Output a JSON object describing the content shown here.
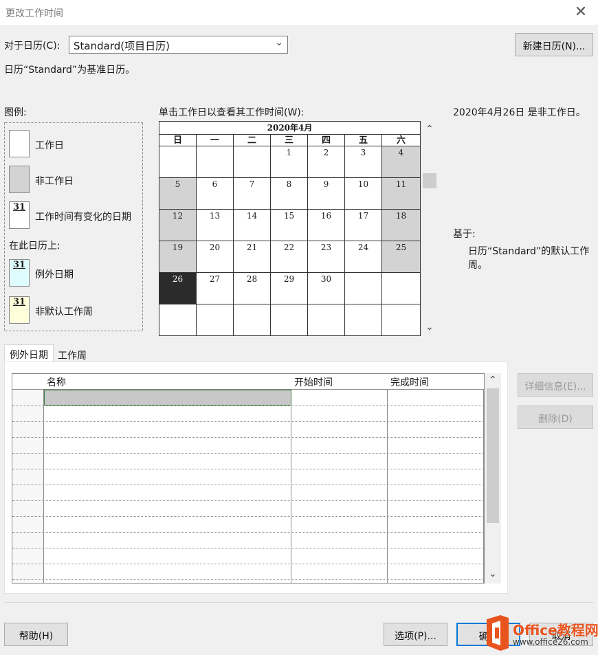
{
  "window": {
    "title": "更改工作时间",
    "close_glyph": "✕"
  },
  "calendar_select": {
    "label": "对于日历(C):",
    "value": "Standard(项目日历)",
    "chevron": "⌄"
  },
  "base_note": "日历“Standard”为基准日历。",
  "new_calendar_button": "新建日历(N)...",
  "legend": {
    "heading": "图例:",
    "items": [
      {
        "label": "工作日",
        "swatch": "",
        "bg": "#ffffff"
      },
      {
        "label": "非工作日",
        "swatch": "",
        "bg": "#d3d3d3"
      },
      {
        "label": "工作时间有变化的日期",
        "swatch": "31",
        "bg": "#ffffff"
      }
    ],
    "on_calendar_heading": "在此日历上:",
    "calendar_items": [
      {
        "label": "例外日期",
        "swatch": "31",
        "bg": "#dffdff"
      },
      {
        "label": "非默认工作周",
        "swatch": "31",
        "bg": "#ffffdc"
      }
    ]
  },
  "calendar": {
    "instruction": "单击工作日以查看其工作时间(W):",
    "month_title": "2020年4月",
    "weekdays": [
      "日",
      "一",
      "二",
      "三",
      "四",
      "五",
      "六"
    ],
    "weeks": [
      [
        "",
        "",
        "",
        "1",
        "2",
        "3",
        "4"
      ],
      [
        "5",
        "6",
        "7",
        "8",
        "9",
        "10",
        "11"
      ],
      [
        "12",
        "13",
        "14",
        "15",
        "16",
        "17",
        "18"
      ],
      [
        "19",
        "20",
        "21",
        "22",
        "23",
        "24",
        "25"
      ],
      [
        "26",
        "27",
        "28",
        "29",
        "30",
        "",
        ""
      ],
      [
        "",
        "",
        "",
        "",
        "",
        "",
        ""
      ]
    ],
    "selected_day": "26",
    "scroll_up": "⌃",
    "scroll_down": "⌄"
  },
  "info": {
    "selected_status": "2020年4月26日 是非工作日。",
    "based_on_label": "基于:",
    "based_on_line1": "日历“Standard”的默认工作",
    "based_on_line2": "周。"
  },
  "tabs": [
    {
      "label": "例外日期",
      "active": true
    },
    {
      "label": "工作周",
      "active": false
    }
  ],
  "exceptions_grid": {
    "columns": [
      "名称",
      "开始时间",
      "完成时间"
    ],
    "row_count": 12,
    "scroll_up": "⌃",
    "scroll_down": "⌄"
  },
  "side_buttons": {
    "details": "详细信息(E)...",
    "delete": "删除(D)"
  },
  "footer": {
    "help": "帮助(H)",
    "options": "选项(P)...",
    "ok": "确定",
    "cancel": "取消"
  },
  "watermark": {
    "brand": "Office教程网",
    "url": "www.office26.com"
  },
  "colors": {
    "nonworking": "#d3d3d3",
    "selected_day": "#2b2b2b",
    "dialog_bg": "#f0f0f0",
    "grid_selection": "#c8c8c8",
    "logo_orange": "#e8541e"
  }
}
